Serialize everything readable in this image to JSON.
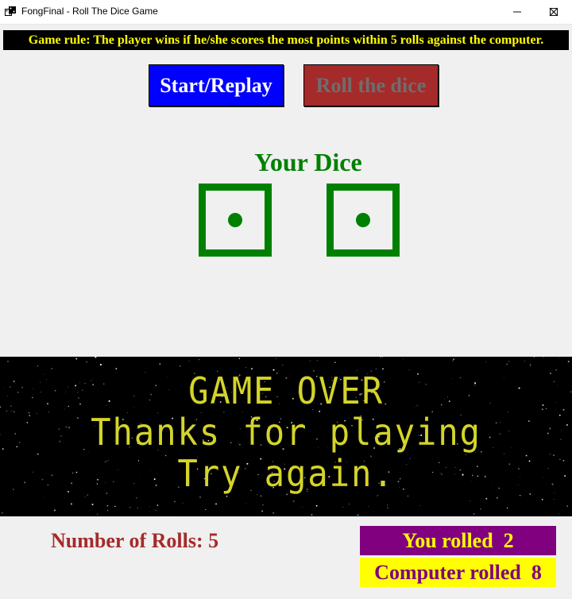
{
  "window": {
    "title": "FongFinal - Roll The Dice Game",
    "minimize_glyph": "—",
    "maximize_glyph": "☐",
    "close_glyph": "✕",
    "icon": "dice-icon"
  },
  "rule_text": "Game rule: The player wins if he/she scores the most points within 5 rolls against the computer.",
  "buttons": {
    "start_label": "Start/Replay",
    "roll_label": "Roll the dice"
  },
  "dice_section": {
    "heading": "Your Dice",
    "dice_values": [
      1,
      1
    ]
  },
  "banner": {
    "line1": "GAME OVER",
    "line2": "Thanks for playing",
    "line3": "Try again."
  },
  "stats": {
    "rolls_text": "Number of Rolls: 5",
    "you_rolled_text": "You rolled  2",
    "computer_rolled_text": "Computer rolled  8"
  },
  "colors": {
    "start_button": "#0000ff",
    "roll_button": "#a52a2a",
    "dice": "#008000",
    "banner_text": "#d4d42a",
    "you_rolled_bg": "#800080",
    "computer_rolled_bg": "#ffff00"
  }
}
